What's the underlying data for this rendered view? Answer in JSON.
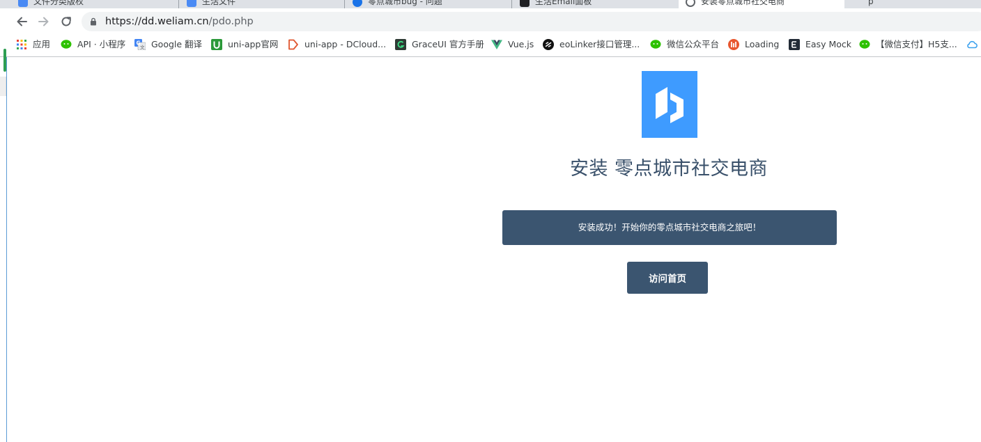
{
  "browser": {
    "tabs": [
      {
        "label": "文件分类版权",
        "favicon_color": "#4a8af4"
      },
      {
        "label": "生活文件",
        "favicon_color": "#4a8af4"
      },
      {
        "label": "零点城市bug - 问题",
        "favicon_color": "#1a73e8"
      },
      {
        "label": "生活Email面板",
        "favicon_color": "#202124"
      },
      {
        "label": "安装零点城市社交电商",
        "favicon_color": "#5f6368",
        "active": true
      },
      {
        "label": "p",
        "favicon_color": "#5f6368"
      }
    ],
    "url": {
      "host": "https://dd.weliam.cn",
      "path": "/pdo.php"
    },
    "bookmarks": [
      {
        "label": "应用",
        "icon": "apps-grid-icon"
      },
      {
        "label": "API · 小程序",
        "icon": "wechat-icon"
      },
      {
        "label": "Google 翻译",
        "icon": "google-translate-icon"
      },
      {
        "label": "uni-app官网",
        "icon": "uni-app-icon"
      },
      {
        "label": "uni-app - DCloud...",
        "icon": "dcloud-icon"
      },
      {
        "label": "GraceUI 官方手册",
        "icon": "graceui-icon"
      },
      {
        "label": "Vue.js",
        "icon": "vue-icon"
      },
      {
        "label": "eoLinker接口管理...",
        "icon": "eolinker-icon"
      },
      {
        "label": "微信公众平台",
        "icon": "wechat-icon"
      },
      {
        "label": "Loading",
        "icon": "loading-icon"
      },
      {
        "label": "Easy Mock",
        "icon": "easy-mock-icon"
      },
      {
        "label": "【微信支付】H5支...",
        "icon": "wechat-icon"
      },
      {
        "label": "",
        "icon": "cloud-icon"
      }
    ]
  },
  "page": {
    "logo_icon": "brand-logo-icon",
    "title": "安装 零点城市社交电商",
    "success_message": "安装成功！开始你的零点城市社交电商之旅吧！",
    "visit_home_label": "访问首页"
  },
  "colors": {
    "accent": "#3b5570",
    "logo_bg": "#3e9bff",
    "title": "#39506a"
  }
}
